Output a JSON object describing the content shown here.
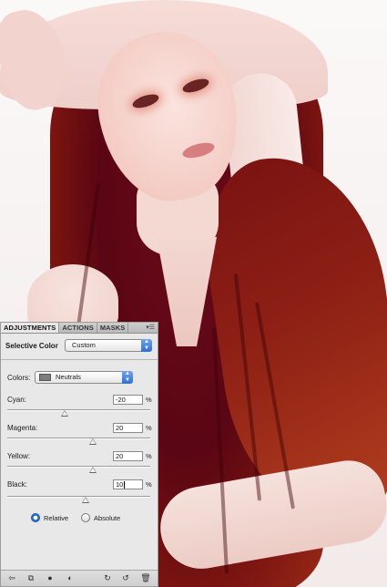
{
  "panel": {
    "tabs": [
      "ADJUSTMENTS",
      "ACTIONS",
      "MASKS"
    ],
    "menu_icon": "panel-menu-icon",
    "title": "Selective Color",
    "preset": "Custom",
    "colors_label": "Colors:",
    "colors_value": "Neutrals",
    "sliders": [
      {
        "label": "Cyan:",
        "value": "-20",
        "unit": "%",
        "level": -0.2
      },
      {
        "label": "Magenta:",
        "value": "20",
        "unit": "%",
        "level": 0.2
      },
      {
        "label": "Yellow:",
        "value": "20",
        "unit": "%",
        "level": 0.2
      },
      {
        "label": "Black:",
        "value": "10",
        "unit": "%",
        "level": 0.1
      }
    ],
    "method": {
      "relative_label": "Relative",
      "absolute_label": "Absolute",
      "selected": "Relative"
    },
    "footer_icons": [
      "back-arrow-icon",
      "layer-clip-icon",
      "visibility-icon",
      "mask-icon",
      "previous-state-icon",
      "reset-icon",
      "trash-icon"
    ]
  },
  "accent_color": "#2e6fd6"
}
